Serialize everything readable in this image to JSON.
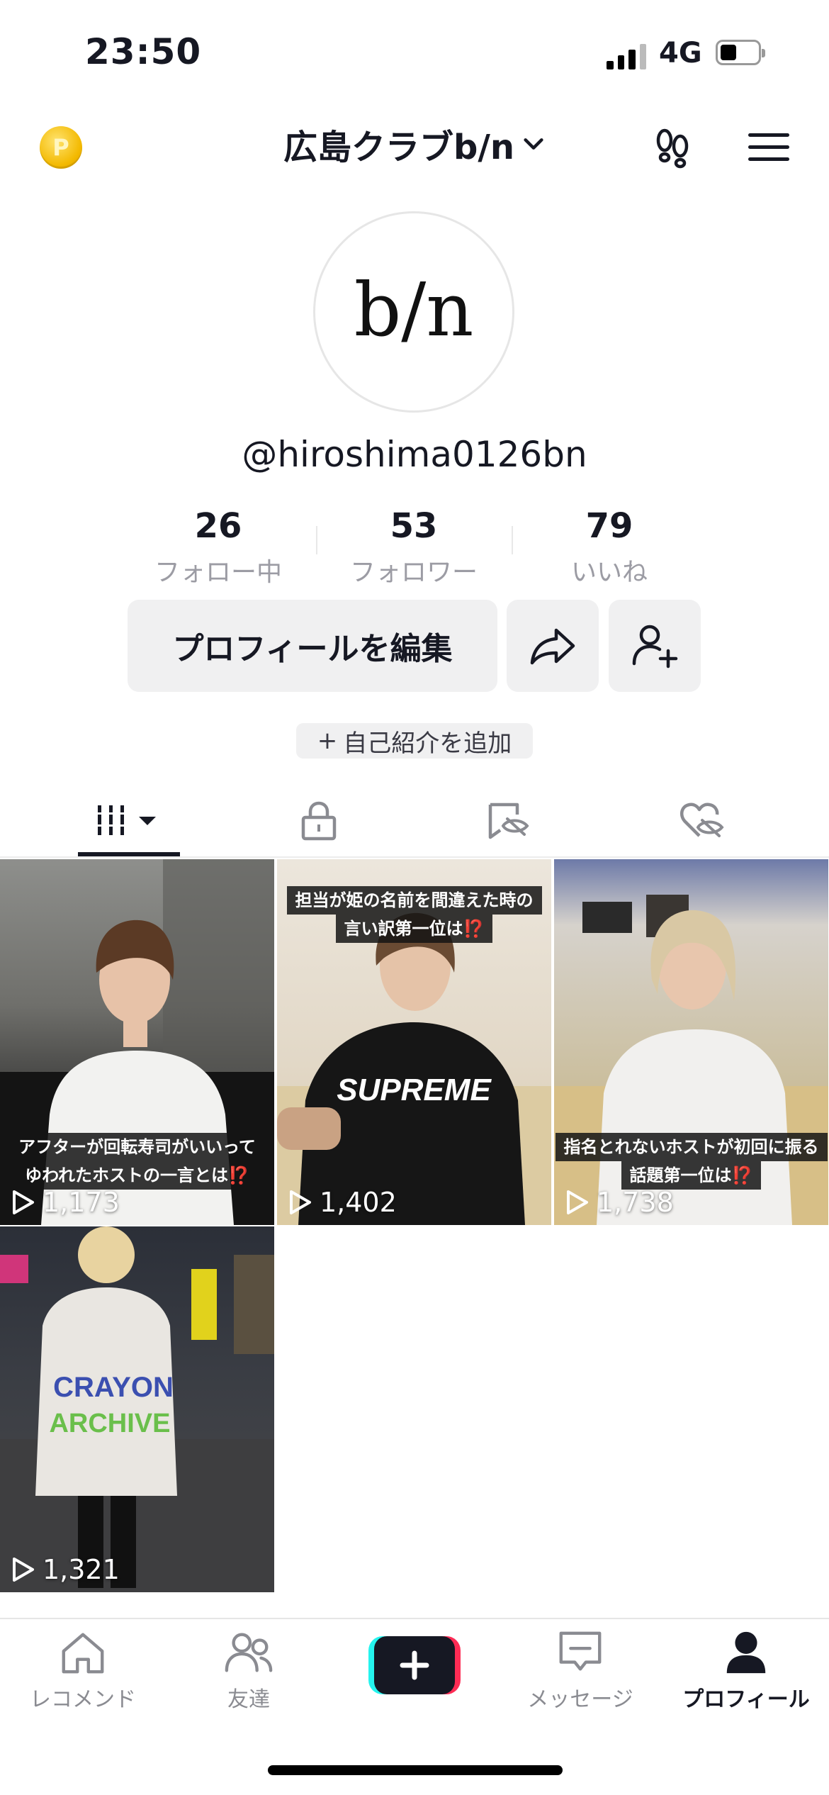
{
  "status": {
    "time": "23:50",
    "network": "4G"
  },
  "header": {
    "coin_letter": "P",
    "account_name": "広島クラブb/n"
  },
  "profile": {
    "logo_text": "b/n",
    "handle": "@hiroshima0126bn",
    "stats": [
      {
        "value": "26",
        "label": "フォロー中"
      },
      {
        "value": "53",
        "label": "フォロワー"
      },
      {
        "value": "79",
        "label": "いいね"
      }
    ],
    "edit_label": "プロフィールを編集",
    "bio_label": "自己紹介を追加"
  },
  "videos": [
    {
      "views": "1,173",
      "caption_lines": [
        "アフターが回転寿司がいいって",
        "ゆわれたホストの一言とは⁉️"
      ]
    },
    {
      "views": "1,402",
      "caption_lines": [
        "担当が姫の名前を間違えた時の",
        "言い訳第一位は⁉️"
      ]
    },
    {
      "views": "1,738",
      "caption_lines": [
        "指名とれないホストが初回に振る",
        "話題第一位は⁉️"
      ]
    },
    {
      "views": "1,321",
      "caption_lines": []
    }
  ],
  "nav": [
    {
      "label": "レコメンド",
      "icon": "home-icon"
    },
    {
      "label": "友達",
      "icon": "friends-icon"
    },
    {
      "label": "",
      "icon": "plus-icon"
    },
    {
      "label": "メッセージ",
      "icon": "message-icon"
    },
    {
      "label": "プロフィール",
      "icon": "profile-icon",
      "active": true
    }
  ],
  "colors": {
    "accent_red": "#fe2c55",
    "accent_cyan": "#25f4ee",
    "text": "#161823",
    "muted": "#9c9ca4"
  }
}
